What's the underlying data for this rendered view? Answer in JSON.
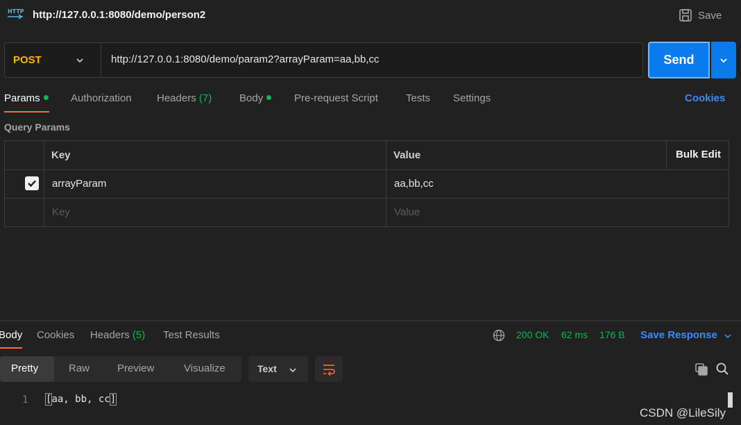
{
  "header": {
    "title": "http://127.0.0.1:8080/demo/person2",
    "save_label": "Save"
  },
  "request": {
    "method": "POST",
    "url": "http://127.0.0.1:8080/demo/param2?arrayParam=aa,bb,cc",
    "send_label": "Send"
  },
  "request_tabs": {
    "params": "Params",
    "authorization": "Authorization",
    "headers": "Headers",
    "headers_count": "(7)",
    "body": "Body",
    "pre_request": "Pre-request Script",
    "tests": "Tests",
    "settings": "Settings",
    "cookies": "Cookies"
  },
  "query_params": {
    "title": "Query Params",
    "col_key": "Key",
    "col_value": "Value",
    "bulk_edit": "Bulk Edit",
    "rows": [
      {
        "checked": true,
        "key": "arrayParam",
        "value": "aa,bb,cc"
      }
    ],
    "key_placeholder": "Key",
    "value_placeholder": "Value"
  },
  "response_tabs": {
    "body": "Body",
    "cookies": "Cookies",
    "headers": "Headers",
    "headers_count": "(5)",
    "test_results": "Test Results"
  },
  "response_status": {
    "status": "200 OK",
    "time": "62 ms",
    "size": "176 B",
    "save_response": "Save Response"
  },
  "response_view": {
    "pretty": "Pretty",
    "raw": "Raw",
    "preview": "Preview",
    "visualize": "Visualize",
    "format": "Text"
  },
  "response_body": {
    "line_number": "1",
    "open_bracket": "[",
    "content": "aa, bb, cc",
    "close_bracket": "]"
  },
  "watermark": "CSDN @LileSily",
  "colors": {
    "accent": "#ff6c37",
    "send": "#097bed",
    "method": "#ffb400",
    "success": "#0cbb52",
    "link": "#3c8cf5"
  }
}
